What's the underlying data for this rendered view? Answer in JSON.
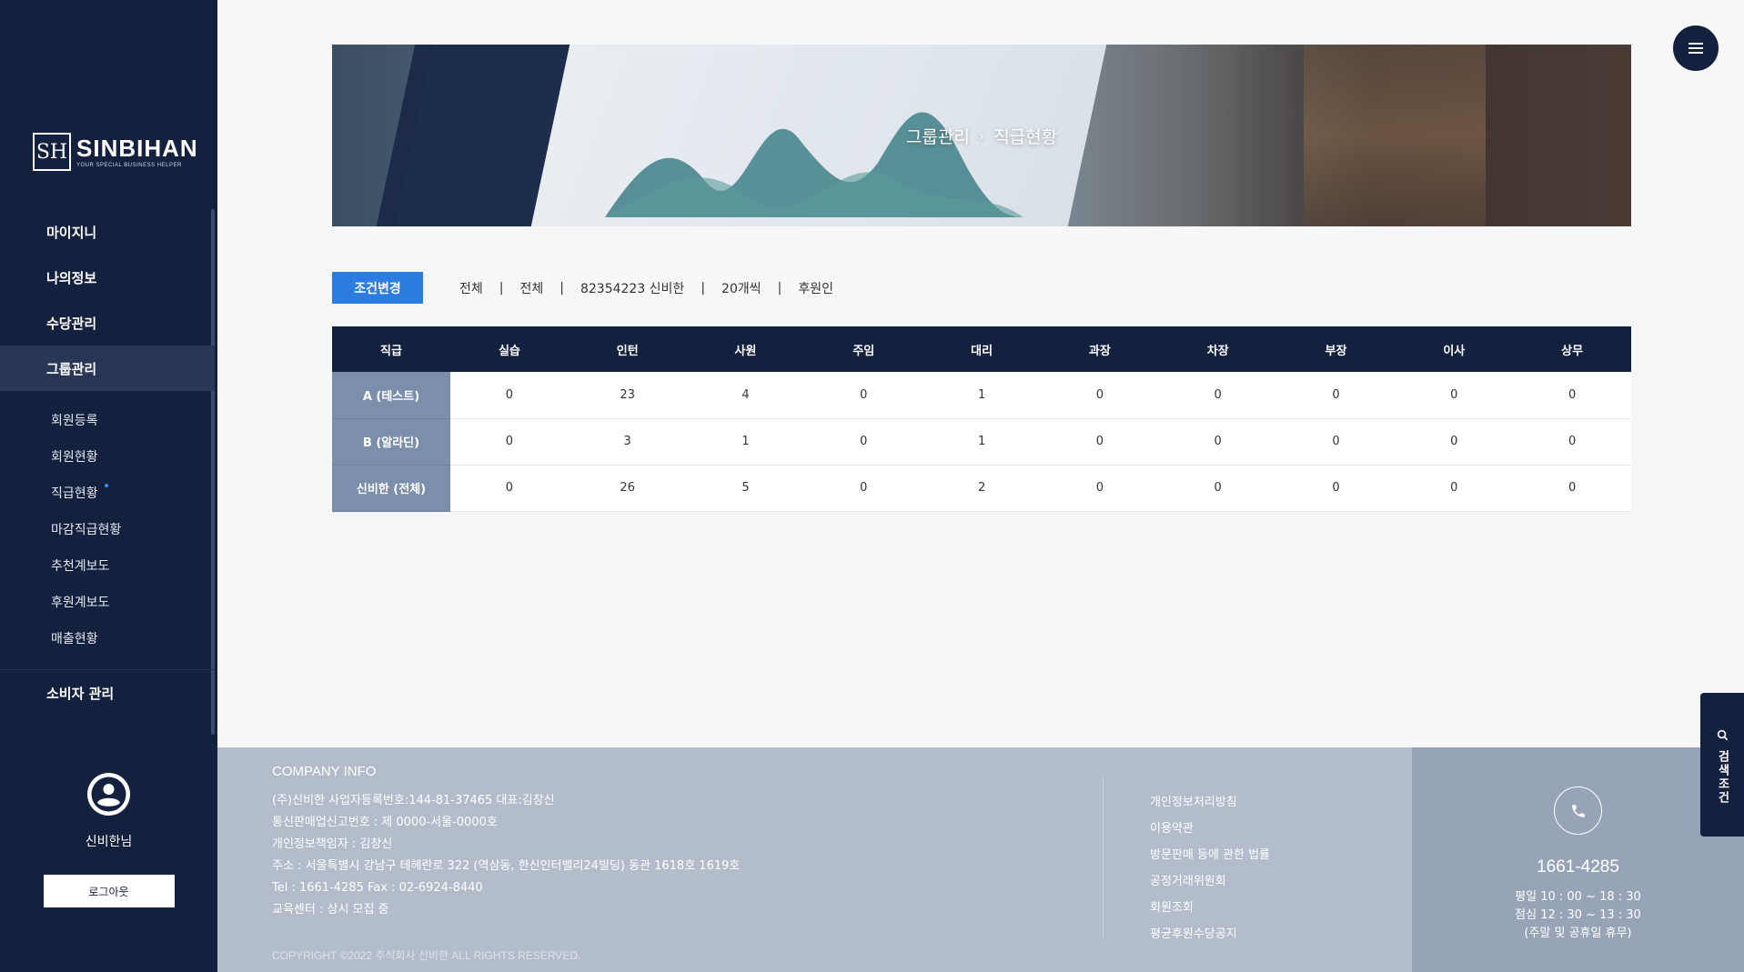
{
  "brand": {
    "name": "SINBIHAN",
    "tagline": "YOUR SPECIAL BUSINESS HELPER",
    "mark": "SH"
  },
  "nav": {
    "items": [
      {
        "label": "마이지니"
      },
      {
        "label": "나의정보"
      },
      {
        "label": "수당관리"
      },
      {
        "label": "그룹관리",
        "active": true
      }
    ],
    "sub_items": [
      {
        "label": "회원등록"
      },
      {
        "label": "회원현황"
      },
      {
        "label": "직급현황",
        "active": true
      },
      {
        "label": "마감직급현황"
      },
      {
        "label": "추천계보도"
      },
      {
        "label": "후원계보도"
      },
      {
        "label": "매출현황"
      }
    ],
    "bottom_item": {
      "label": "소비자 관리"
    }
  },
  "profile": {
    "name": "신비한님",
    "logout_label": "로그아웃"
  },
  "banner": {
    "crumb1": "그룹관리",
    "separator": "›",
    "crumb2": "직급현황"
  },
  "filter": {
    "button_label": "조건변경",
    "items": [
      "전체",
      "전체",
      "82354223 신비한",
      "20개씩",
      "후원인"
    ],
    "separator": "|"
  },
  "table": {
    "headers": [
      "직급",
      "실습",
      "인턴",
      "사원",
      "주임",
      "대리",
      "과장",
      "차장",
      "부장",
      "이사",
      "상무"
    ],
    "rows": [
      {
        "label": "A (테스트)",
        "values": [
          "0",
          "23",
          "4",
          "0",
          "1",
          "0",
          "0",
          "0",
          "0",
          "0"
        ]
      },
      {
        "label": "B (알라딘)",
        "values": [
          "0",
          "3",
          "1",
          "0",
          "1",
          "0",
          "0",
          "0",
          "0",
          "0"
        ]
      },
      {
        "label": "신비한 (전체)",
        "values": [
          "0",
          "26",
          "5",
          "0",
          "2",
          "0",
          "0",
          "0",
          "0",
          "0"
        ]
      }
    ]
  },
  "footer": {
    "title": "COMPANY INFO",
    "lines": [
      "(주)신비한    사업자등록번호:144-81-37465    대표:김창신",
      "통신판매업신고번호 : 제 0000-서울-0000호",
      "개인정보책임자 : 김창신",
      "주소 : 서울특별시 강남구 테헤란로 322 (역삼동, 한신인터밸리24빌딩) 동관 1618호 1619호",
      "Tel : 1661-4285    Fax : 02-6924-8440",
      "교육센터 : 상시 모집 중"
    ],
    "copyright": "COPYRIGHT ©2022 주식회사 신비한 ALL RIGHTS RESERVED.",
    "links": [
      "개인정보처리방침",
      "이용약관",
      "방문판매 등에 관한 법률",
      "공정거래위원회",
      "회원조회",
      "평균후원수당공지"
    ],
    "cs": {
      "number": "1661-4285",
      "hours1": "평일 10 : 00 ~ 18 : 30",
      "hours2": "점심 12 : 30 ~ 13 : 30",
      "hours3": "(주말 및 공휴일 휴무)"
    }
  },
  "search_tab": {
    "label": "검색조건"
  },
  "colors": {
    "navy": "#13213f",
    "accent": "#2b7de0",
    "row_head": "#7b8fab",
    "footer": "#b2bcca"
  },
  "icons": {
    "menu": "hamburger-icon",
    "avatar": "user-circle-icon",
    "phone": "phone-icon",
    "search": "search-icon"
  }
}
